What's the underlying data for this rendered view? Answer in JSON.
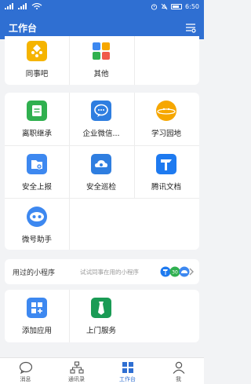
{
  "status_bar": {
    "time": "6:50"
  },
  "header": {
    "title": "工作台"
  },
  "section1": {
    "items": [
      {
        "label": "同事吧",
        "icon": "colleague-bar-icon",
        "color": "#f5b400"
      },
      {
        "label": "其他",
        "icon": "other-apps-icon",
        "color": "#ffffff"
      }
    ]
  },
  "section2": {
    "items": [
      {
        "label": "离职继承",
        "icon": "resignation-inherit-icon",
        "color": "#30b04f"
      },
      {
        "label": "企业微信...",
        "icon": "wechat-work-icon",
        "color": "#2f7ee0"
      },
      {
        "label": "学习园地",
        "icon": "learning-planet-icon",
        "color": "#f6a700"
      },
      {
        "label": "安全上报",
        "icon": "security-report-icon",
        "color": "#3d88f0"
      },
      {
        "label": "安全巡检",
        "icon": "security-inspection-icon",
        "color": "#2f7ee0"
      },
      {
        "label": "腾讯文档",
        "icon": "tencent-docs-icon",
        "color": "#1e7af0"
      },
      {
        "label": "微号助手",
        "icon": "wechat-assistant-icon",
        "color": "#3d88f0"
      }
    ]
  },
  "mini_programs": {
    "title": "用过的小程序",
    "hint": "试试同事在用的小程序"
  },
  "section3": {
    "items": [
      {
        "label": "添加应用",
        "icon": "add-app-icon",
        "color": "#3d88f0"
      },
      {
        "label": "上门服务",
        "icon": "door-service-icon",
        "color": "#1a9b55"
      }
    ]
  },
  "bottom_nav": {
    "items": [
      {
        "label": "消息",
        "icon": "message-icon"
      },
      {
        "label": "通讯录",
        "icon": "contacts-icon"
      },
      {
        "label": "工作台",
        "icon": "workbench-icon"
      },
      {
        "label": "我",
        "icon": "profile-icon"
      }
    ]
  },
  "colors": {
    "primary": "#2f6fd2",
    "background": "#f2f3f5"
  }
}
